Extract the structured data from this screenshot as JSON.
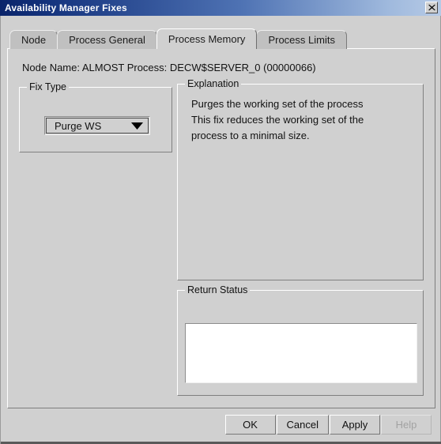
{
  "window": {
    "title": "Availability Manager Fixes",
    "close_icon": "close-icon"
  },
  "tabs": [
    {
      "label": "Node",
      "selected": false
    },
    {
      "label": "Process General",
      "selected": false
    },
    {
      "label": "Process Memory",
      "selected": true
    },
    {
      "label": "Process Limits",
      "selected": false
    }
  ],
  "content": {
    "node_line": "Node Name:  ALMOST  Process:  DECW$SERVER_0 (00000066)",
    "fix_type": {
      "group_title": "Fix Type",
      "selected_value": "Purge WS",
      "arrow_icon": "chevron-down-icon"
    },
    "explanation": {
      "group_title": "Explanation",
      "line1": "Purges the working set of the process",
      "line2": "This fix reduces the working set of the",
      "line3": "process to a minimal size."
    },
    "return_status": {
      "group_title": "Return Status",
      "value": ""
    }
  },
  "buttons": {
    "ok": "OK",
    "cancel": "Cancel",
    "apply": "Apply",
    "help": "Help"
  },
  "colors": {
    "title_start": "#0a246a",
    "title_end": "#b6cae6",
    "face": "#d0d0d0",
    "tab_unselected": "#c0c0c0",
    "field_background": "#ffffff",
    "disabled_text": "#a2a2a2"
  }
}
